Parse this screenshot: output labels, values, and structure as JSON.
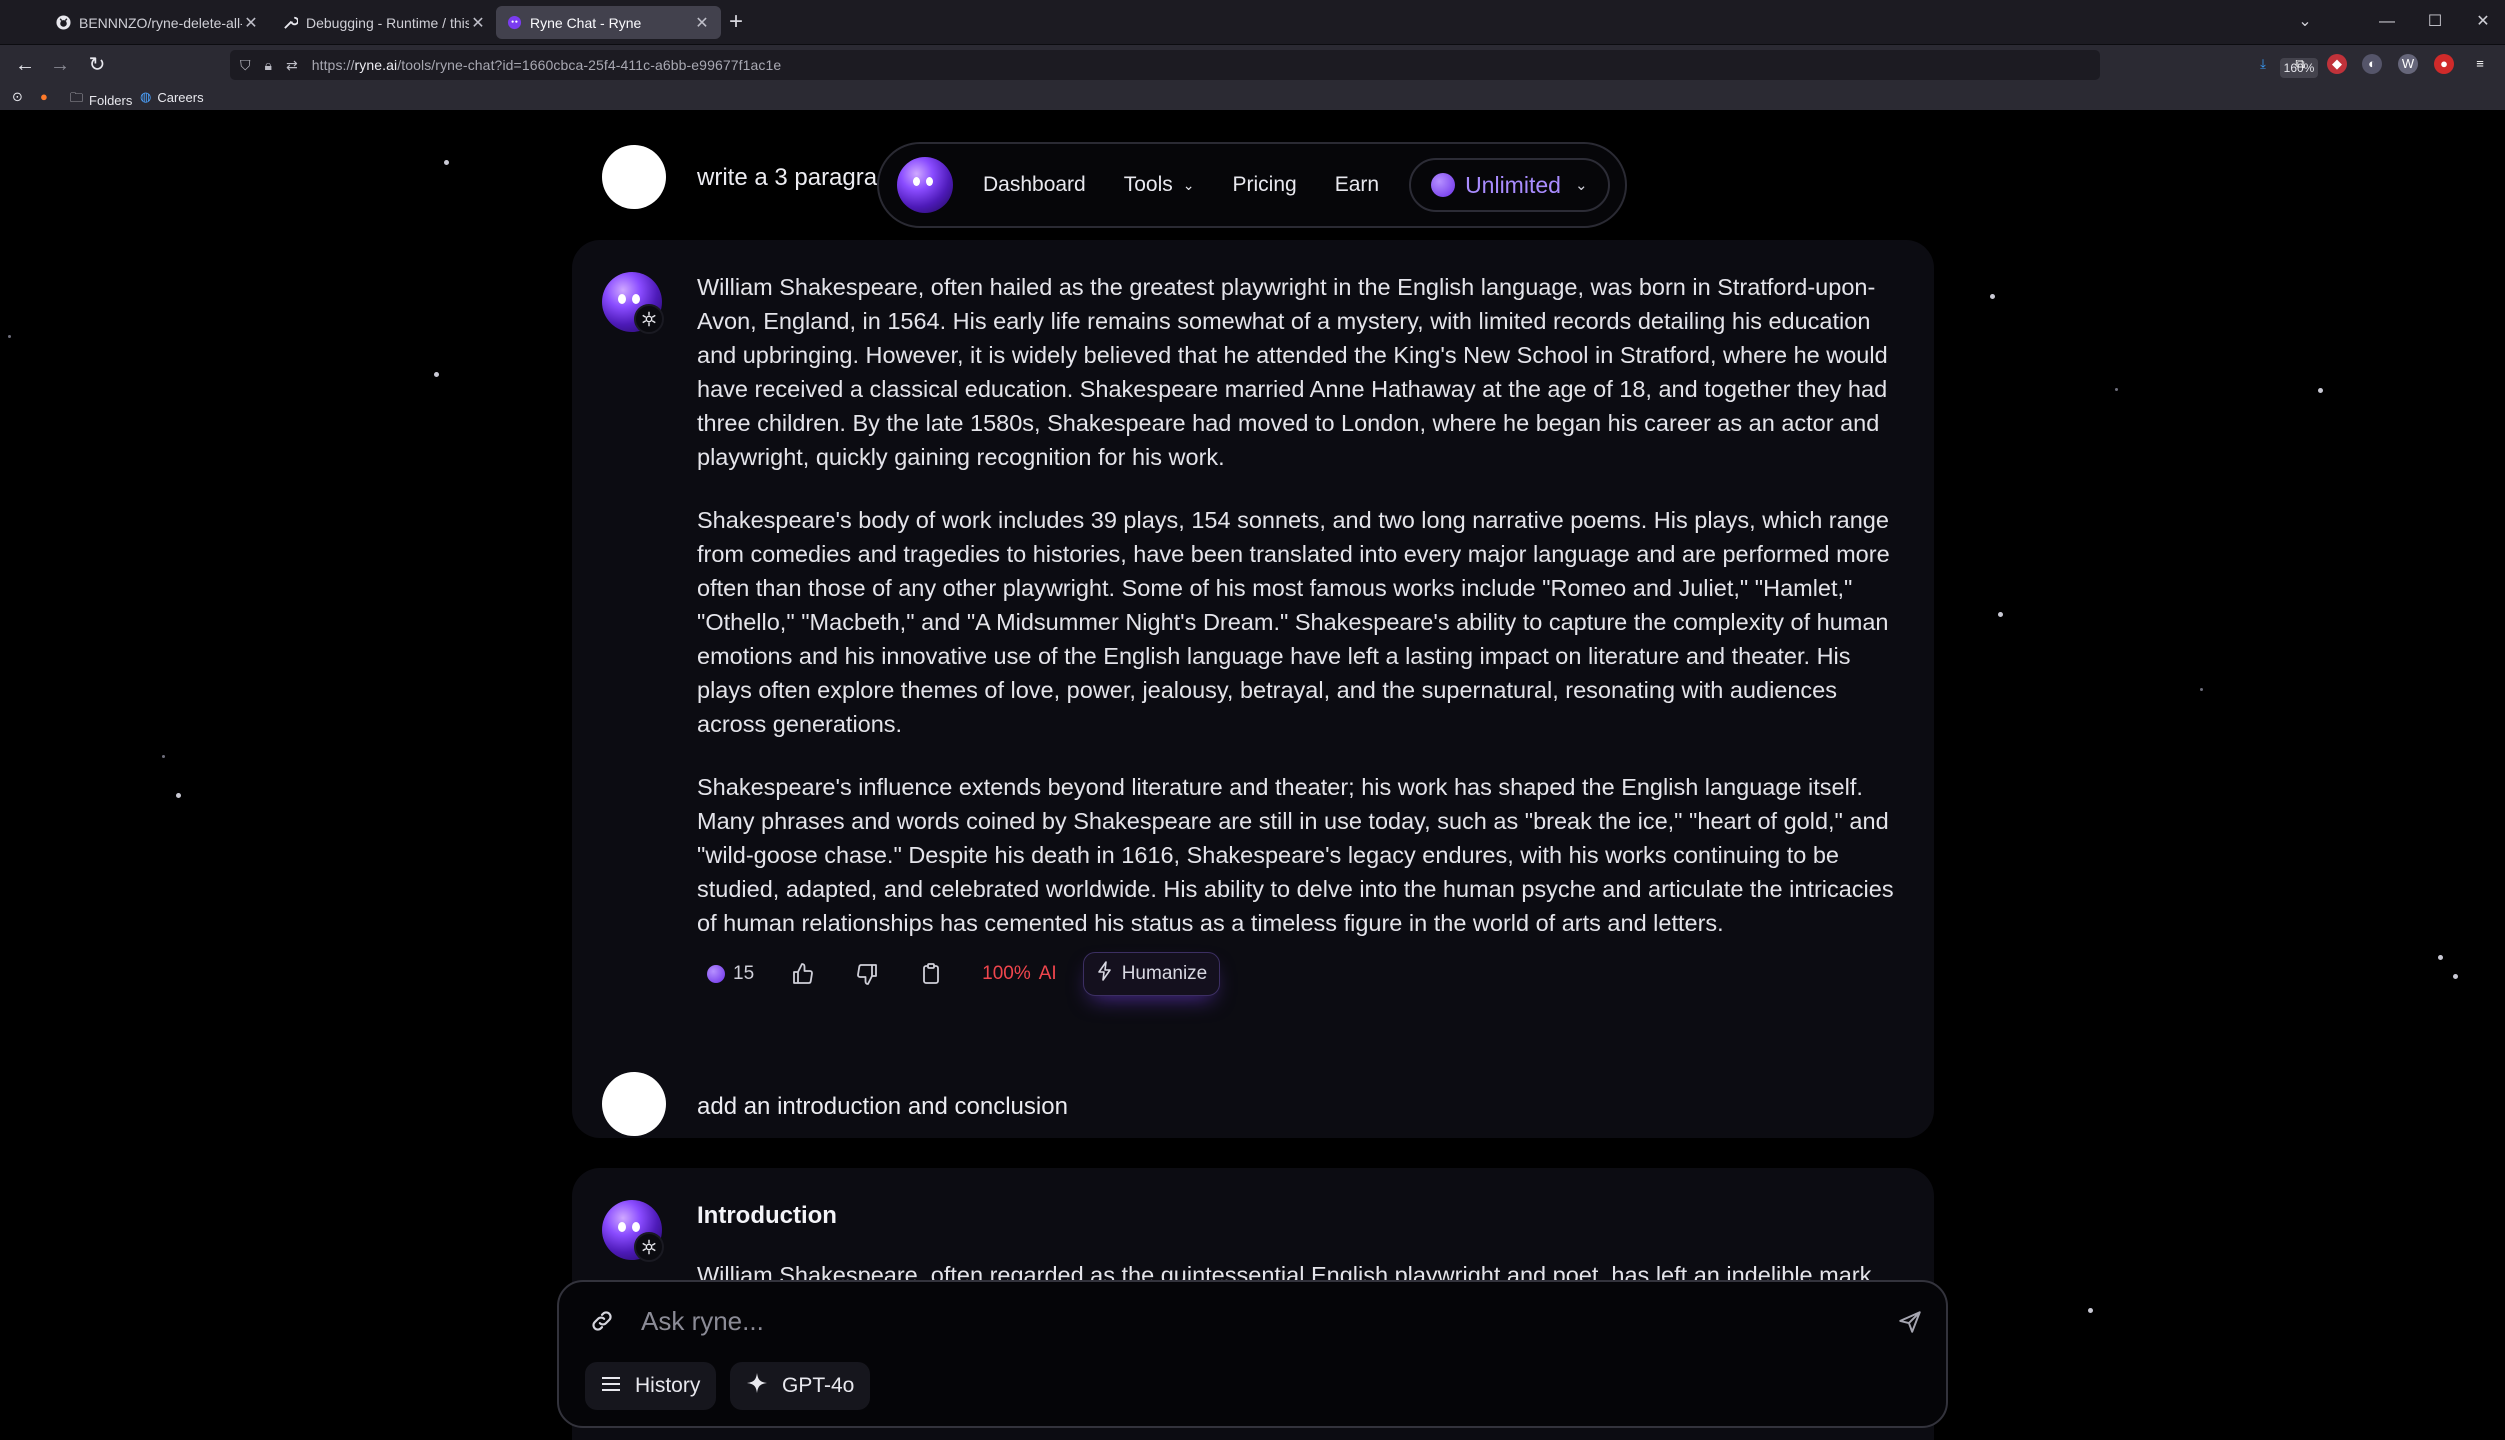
{
  "browser": {
    "tabs": [
      {
        "title": "BENNNZO/ryne-delete-all-exte",
        "active": false,
        "icon": "github-icon"
      },
      {
        "title": "Debugging - Runtime / this-fire",
        "active": false,
        "icon": "wrench-icon"
      },
      {
        "title": "Ryne Chat - Ryne",
        "active": true,
        "icon": "ryne-icon"
      }
    ],
    "url_prefix": "https://",
    "url_host": "ryne.ai",
    "url_path": "/tools/ryne-chat?id=1660cbca-25f4-411c-a6bb-e99677f1ac1e",
    "zoom": "160%",
    "bookmarks": [
      {
        "label": "Folders",
        "icon": "folder-icon"
      },
      {
        "label": "Careers",
        "icon": "careers-icon"
      }
    ]
  },
  "nav": {
    "links": [
      "Dashboard",
      "Tools",
      "Pricing",
      "Earn"
    ],
    "plan": "Unlimited"
  },
  "chat": {
    "first_user_message": "write a 3 paragra",
    "first_reply": {
      "paragraphs": [
        "William Shakespeare, often hailed as the greatest playwright in the English language, was born in Stratford-upon-Avon, England, in 1564. His early life remains somewhat of a mystery, with limited records detailing his education and upbringing. However, it is widely believed that he attended the King's New School in Stratford, where he would have received a classical education. Shakespeare married Anne Hathaway at the age of 18, and together they had three children. By the late 1580s, Shakespeare had moved to London, where he began his career as an actor and playwright, quickly gaining recognition for his work.",
        "Shakespeare's body of work includes 39 plays, 154 sonnets, and two long narrative poems. His plays, which range from comedies and tragedies to histories, have been translated into every major language and are performed more often than those of any other playwright. Some of his most famous works include \"Romeo and Juliet,\" \"Hamlet,\" \"Othello,\" \"Macbeth,\" and \"A Midsummer Night's Dream.\" Shakespeare's ability to capture the complexity of human emotions and his innovative use of the English language have left a lasting impact on literature and theater. His plays often explore themes of love, power, jealousy, betrayal, and the supernatural, resonating with audiences across generations.",
        "Shakespeare's influence extends beyond literature and theater; his work has shaped the English language itself. Many phrases and words coined by Shakespeare are still in use today, such as \"break the ice,\" \"heart of gold,\" and \"wild-goose chase.\" Despite his death in 1616, Shakespeare's legacy endures, with his works continuing to be studied, adapted, and celebrated worldwide. His ability to delve into the human psyche and articulate the intricacies of human relationships has cemented his status as a timeless figure in the world of arts and letters."
      ],
      "credits": "15",
      "ai_percent": "100%",
      "ai_label": "AI",
      "humanize_label": "Humanize"
    },
    "second_user_message": "add an introduction and conclusion",
    "second_reply": {
      "heading": "Introduction",
      "partial_text": "William Shakespeare, often regarded as the quintessential English playwright and poet, has left an indelible mark"
    }
  },
  "composer": {
    "placeholder": "Ask ryne...",
    "history_label": "History",
    "model_label": "GPT-4o"
  },
  "colors": {
    "accent": "#8a4cff",
    "ai_red": "#f0464d",
    "background": "#000000",
    "card": "#0c0c12"
  }
}
